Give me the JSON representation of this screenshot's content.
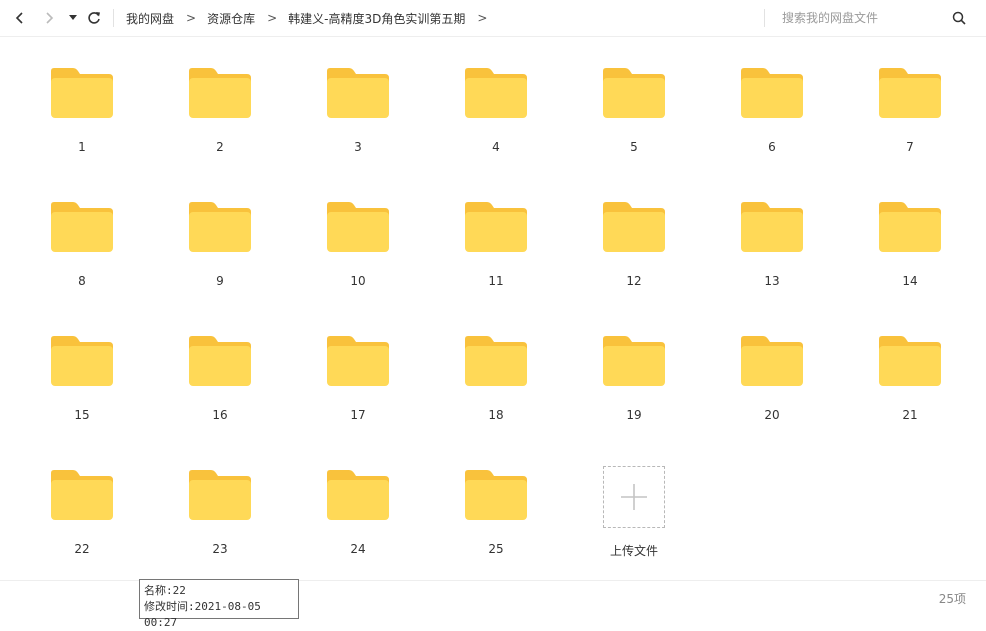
{
  "toolbar": {
    "breadcrumb": [
      "我的网盘",
      "资源仓库",
      "韩建义-高精度3D角色实训第五期"
    ],
    "separator": ">",
    "search_placeholder": "搜索我的网盘文件"
  },
  "folders": [
    "1",
    "2",
    "3",
    "4",
    "5",
    "6",
    "7",
    "8",
    "9",
    "10",
    "11",
    "12",
    "13",
    "14",
    "15",
    "16",
    "17",
    "18",
    "19",
    "20",
    "21",
    "22",
    "23",
    "24",
    "25"
  ],
  "upload": {
    "label": "上传文件"
  },
  "status": {
    "count": "25项"
  },
  "tooltip": {
    "name_line": "名称:22",
    "modified_line": "修改时间:2021-08-05 00:27"
  },
  "colors": {
    "folder_body": "#FFD957",
    "folder_tab": "#F9C23C",
    "accent": "#333333"
  }
}
